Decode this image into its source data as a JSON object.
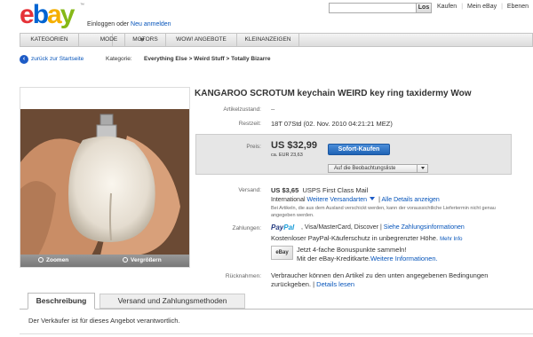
{
  "header": {
    "logo": {
      "e": "e",
      "b": "b",
      "a": "a",
      "y": "y",
      "tm": "™"
    },
    "login_prefix": "Einloggen oder ",
    "login_link": "Neu anmelden",
    "search": {
      "button": "Los",
      "value": ""
    },
    "links": [
      "Kaufen",
      "Mein eBay",
      "Ebenen"
    ],
    "icon_back": "back-arrow-icon",
    "colors": {
      "e": "#e53238",
      "b": "#0064d2",
      "a": "#f5af02",
      "y": "#86b817"
    }
  },
  "nav": {
    "items": [
      "KATEGORIEN",
      "MODE",
      "MOTORS",
      "WOW! ANGEBOTE",
      "KLEINANZEIGEN"
    ]
  },
  "breadcrumb": {
    "back": "zurück zur Startseite",
    "kategorie": "Kategorie:",
    "path": "Everything Else > Weird Stuff > Totally Bizarre"
  },
  "image_panel": {
    "zoom": "Zoomen",
    "enlarge": "Vergrößern"
  },
  "item": {
    "title": "KANGAROO SCROTUM keychain WEIRD key ring taxidermy Wow",
    "zustand_label": "Artikelzustand:",
    "zustand_value": "--",
    "rest_label": "Restzeit:",
    "rest_value": "18T 07Std (02. Nov. 2010 04:21:21 MEZ)",
    "preis_label": "Preis:",
    "price": "US $32,99",
    "price_eur": "ca. EUR 23,63",
    "buy_button": "Sofort-Kaufen",
    "watch_button": "Auf die Beobachtungsliste",
    "versand_label": "Versand:",
    "ship_price": "US $3,65",
    "ship_service": "USPS First Class Mail",
    "ship_intl": "International",
    "ship_more_services": "Weitere Versandarten",
    "ship_details": "Alle Details anzeigen",
    "ship_note": "Bei Artikeln, die aus dem Ausland verschickt werden, kann der voraussichtliche Liefertermin nicht genau angegeben werden.",
    "zahlungen_label": "Zahlungen:",
    "paypal_1": "Pay",
    "paypal_2": "Pal",
    "pay_methods": ", Visa/MasterCard, Discover",
    "pay_info": "Siehe Zahlungsinformationen",
    "pay_protection": "Kostenloser PayPal-Käuferschutz in unbegrenzter Höhe.",
    "pay_more": "Mehr Info",
    "card_label": "eBay",
    "bonus_1": "Jetzt 4-fache Bonuspunkte sammeln!",
    "bonus_2_prefix": "Mit der eBay-Kreditkarte.",
    "bonus_2_link": "Weitere Informationen.",
    "ruecknahmen_label": "Rücknahmen:",
    "returns_text": "Verbraucher können den Artikel zu den unten angegebenen Bedingungen zurückgeben.",
    "returns_link": "Details lesen"
  },
  "tabs": {
    "description": "Beschreibung",
    "shipping": "Versand und Zahlungsmethoden",
    "seller_responsibility": "Der Verkäufer ist für dieses Angebot verantwortlich."
  }
}
